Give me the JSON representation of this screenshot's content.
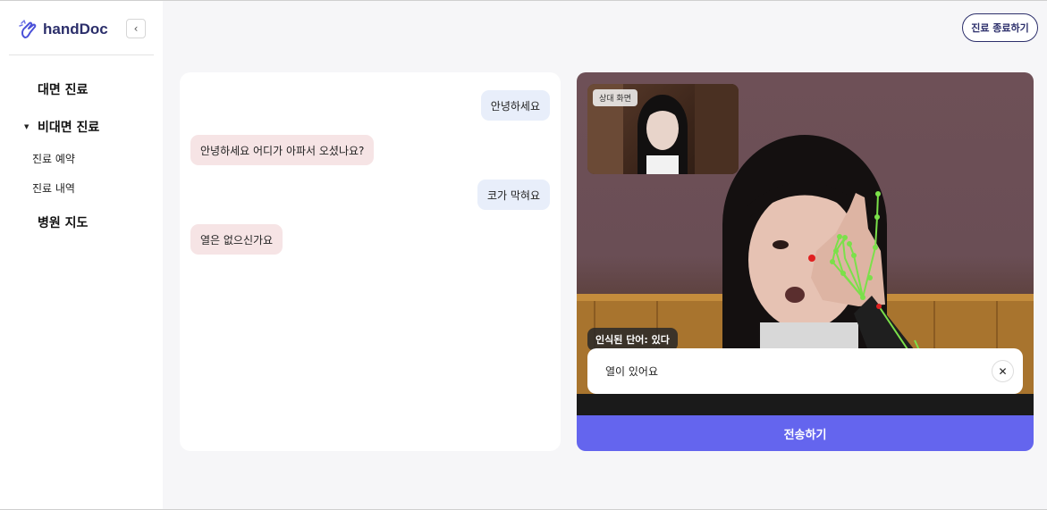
{
  "app": {
    "name": "handDoc"
  },
  "sidebar": {
    "collapse_icon": "chevron-left-icon",
    "items": [
      {
        "label": "대면 진료"
      },
      {
        "label": "비대면 진료",
        "expanded": true,
        "children": [
          {
            "label": "진료 예약"
          },
          {
            "label": "진료 내역"
          }
        ]
      },
      {
        "label": "병원 지도"
      }
    ]
  },
  "header": {
    "end_button": "진료 종료하기"
  },
  "chat": {
    "messages": [
      {
        "from": "me",
        "text": "안녕하세요"
      },
      {
        "from": "other",
        "text": "안녕하세요 어디가 아파서 오셨나요?"
      },
      {
        "from": "me",
        "text": "코가 막혀요"
      },
      {
        "from": "other",
        "text": "열은 없으신가요"
      }
    ]
  },
  "video": {
    "pip_label": "상대 화면",
    "recognized": "인식된 단어: 있다",
    "input_value": "열이 있어요",
    "send_label": "전송하기"
  },
  "colors": {
    "brand": "#2c2f6b",
    "send": "#6465ee",
    "bubble_me": "#e8eefa",
    "bubble_other": "#f6e4e5",
    "landmark": "#7be04a"
  }
}
